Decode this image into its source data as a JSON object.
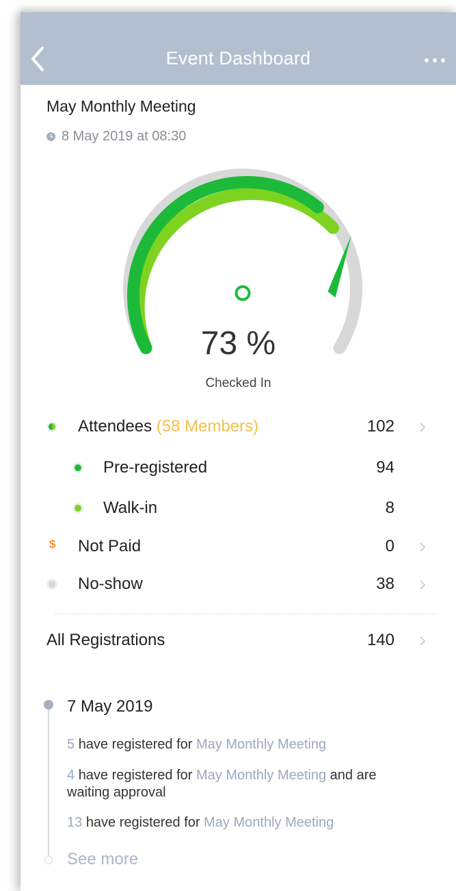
{
  "nav": {
    "title": "Event Dashboard",
    "back_icon": "chevron-left-icon",
    "more_icon": "more-horizontal-icon"
  },
  "event": {
    "title": "May Monthly Meeting",
    "date": "8 May 2019 at 08:30"
  },
  "gauge": {
    "value_text": "73 %",
    "fraction": 0.73,
    "caption": "Checked In"
  },
  "stats": {
    "attendees": {
      "label": "Attendees",
      "members": "(58 Members)",
      "value": "102"
    },
    "pre_registered": {
      "label": "Pre-registered",
      "value": "94"
    },
    "walk_in": {
      "label": "Walk-in",
      "value": "8"
    },
    "not_paid": {
      "label": "Not Paid",
      "icon_text": "$",
      "value": "0"
    },
    "no_show": {
      "label": "No-show",
      "value": "38"
    },
    "all_registrations": {
      "label": "All Registrations",
      "value": "140"
    }
  },
  "timeline": {
    "date": "7 May 2019",
    "items": [
      {
        "count": "5",
        "text": "have registered for",
        "link": "May Monthly Meeting",
        "suffix": ""
      },
      {
        "count": "4",
        "text": "have registered for",
        "link": "May Monthly Meeting",
        "suffix": "and are waiting approval"
      },
      {
        "count": "13",
        "text": "have registered for",
        "link": "May Monthly Meeting",
        "suffix": ""
      }
    ],
    "see_more": "See more"
  },
  "colors": {
    "navbar": "#b3bfcf",
    "green": "#1dba3a",
    "light_green": "#7ed321",
    "gray": "#d8d8d8",
    "members": "#f4c04c",
    "link": "#9ba8bd",
    "dollar": "#f5922f"
  }
}
